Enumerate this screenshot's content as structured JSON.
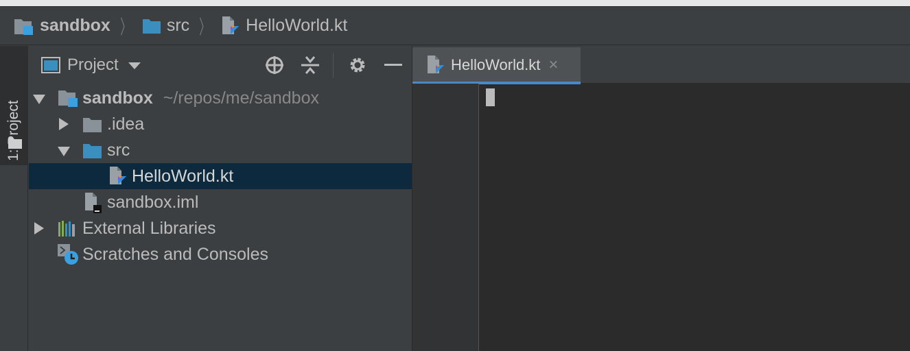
{
  "navbar": {
    "crumbs": [
      "sandbox",
      "src",
      "HelloWorld.kt"
    ]
  },
  "left_tool": {
    "label": "1: Project"
  },
  "project_panel": {
    "title": "Project",
    "icons": [
      "locate-icon",
      "collapse-all-icon",
      "gear-icon",
      "hide-icon"
    ]
  },
  "tree": {
    "root": {
      "name": "sandbox",
      "path": "~/repos/me/sandbox"
    },
    "idea": ".idea",
    "src": "src",
    "file": "HelloWorld.kt",
    "iml": "sandbox.iml",
    "libraries": "External Libraries",
    "scratches": "Scratches and Consoles"
  },
  "editor": {
    "tab_label": "HelloWorld.kt",
    "close_glyph": "×"
  },
  "colors": {
    "background": "#3c3f41",
    "editor": "#2b2b2b",
    "selection": "#0d293e",
    "accent": "#4a88c7",
    "folder_blue": "#3a8fbf"
  }
}
